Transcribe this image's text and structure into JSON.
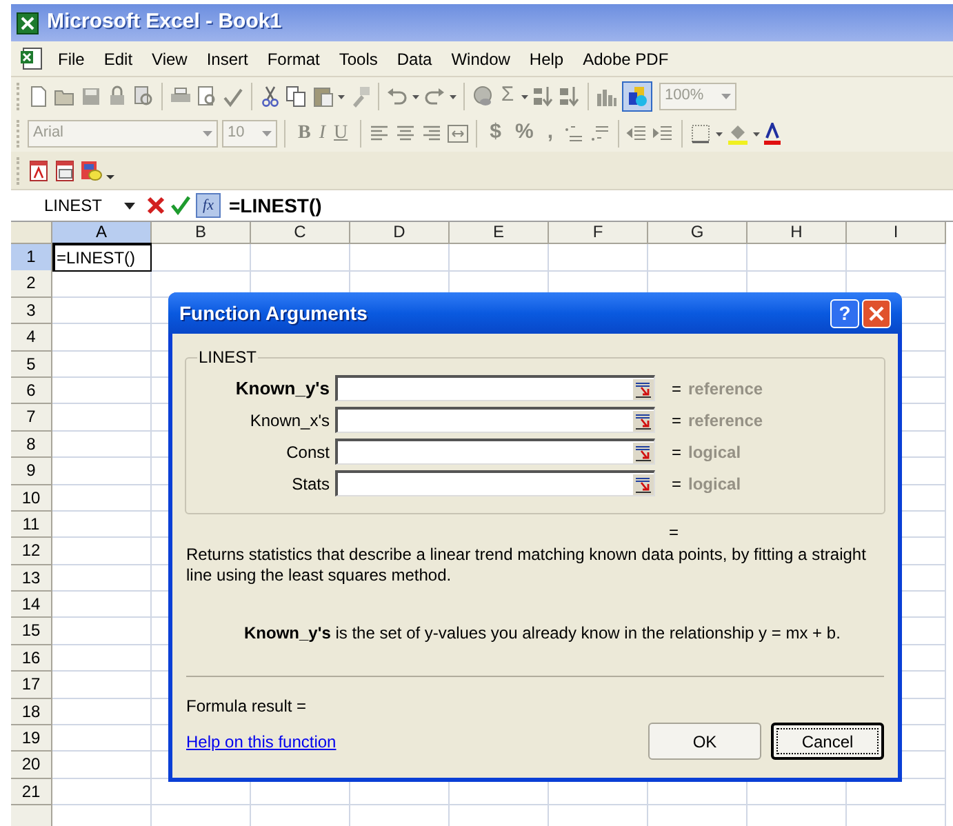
{
  "window": {
    "title": "Microsoft Excel - Book1"
  },
  "menu_bar": [
    "File",
    "Edit",
    "View",
    "Insert",
    "Format",
    "Tools",
    "Data",
    "Window",
    "Help",
    "Adobe PDF"
  ],
  "standard_toolbar": {
    "autosum": "Σ",
    "drawing_pressed": true,
    "zoom": "100%"
  },
  "formatting_toolbar": {
    "font": "Arial",
    "size": "10",
    "style_buttons": [
      "B",
      "I",
      "U"
    ],
    "number_buttons": [
      "$",
      "%",
      ","
    ]
  },
  "formula_bar": {
    "name_box": "LINEST",
    "fx": "fx",
    "formula": "=LINEST()"
  },
  "sheet": {
    "columns": [
      {
        "label": "A",
        "selected": true
      },
      {
        "label": "B",
        "selected": false
      },
      {
        "label": "C",
        "selected": false
      },
      {
        "label": "D",
        "selected": false
      },
      {
        "label": "E",
        "selected": false
      },
      {
        "label": "F",
        "selected": false
      },
      {
        "label": "G",
        "selected": false
      },
      {
        "label": "H",
        "selected": false
      },
      {
        "label": "I",
        "selected": false
      }
    ],
    "rows": [
      {
        "label": "1",
        "selected": true,
        "cells": [
          {
            "value": "=LINEST()",
            "active": true
          }
        ]
      },
      {
        "label": "2",
        "selected": false
      },
      {
        "label": "3",
        "selected": false
      },
      {
        "label": "4",
        "selected": false
      },
      {
        "label": "5",
        "selected": false
      },
      {
        "label": "6",
        "selected": false
      },
      {
        "label": "7",
        "selected": false
      },
      {
        "label": "8",
        "selected": false
      },
      {
        "label": "9",
        "selected": false
      },
      {
        "label": "10",
        "selected": false
      },
      {
        "label": "11",
        "selected": false
      },
      {
        "label": "12",
        "selected": false
      },
      {
        "label": "13",
        "selected": false
      },
      {
        "label": "14",
        "selected": false
      },
      {
        "label": "15",
        "selected": false
      },
      {
        "label": "16",
        "selected": false
      },
      {
        "label": "17",
        "selected": false
      },
      {
        "label": "18",
        "selected": false
      },
      {
        "label": "19",
        "selected": false
      },
      {
        "label": "20",
        "selected": false
      },
      {
        "label": "21",
        "selected": false
      }
    ]
  },
  "dialog": {
    "title": "Function Arguments",
    "help_button": "?",
    "group": "LINEST",
    "arguments": [
      {
        "label": "Known_y's",
        "required": true,
        "equals": "=",
        "type": "reference"
      },
      {
        "label": "Known_x's",
        "required": false,
        "equals": "=",
        "type": "reference"
      },
      {
        "label": "Const",
        "required": false,
        "equals": "=",
        "type": "logical"
      },
      {
        "label": "Stats",
        "required": false,
        "equals": "=",
        "type": "logical"
      }
    ],
    "result_equals": "=",
    "description": "Returns statistics that describe a linear trend matching known data points, by fitting a straight line using the least squares method.",
    "argument_help": "**Known_y's** is the set of y-values you already know in the relationship y = mx + b.",
    "formula_result": "Formula result =",
    "help_link": "Help on this function",
    "buttons": [
      {
        "label": "OK",
        "focused": false
      },
      {
        "label": "Cancel",
        "focused": true
      }
    ]
  }
}
